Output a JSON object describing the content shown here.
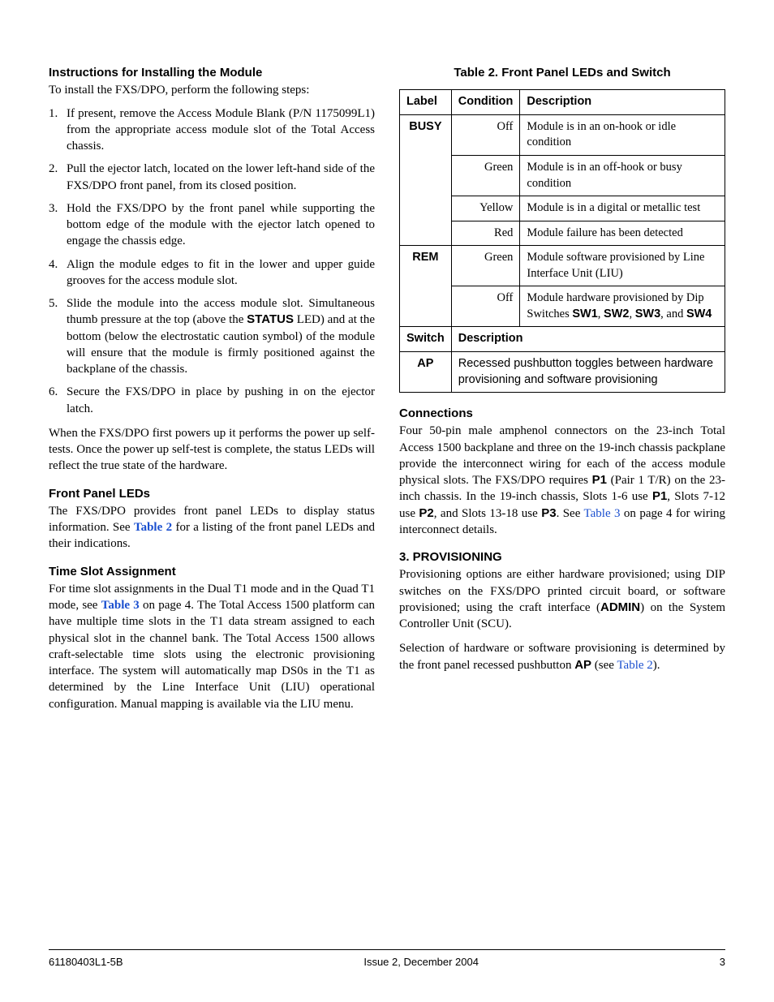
{
  "left": {
    "install_heading": "Instructions for Installing the Module",
    "install_intro": "To install the FXS/DPO, perform the following steps:",
    "steps": [
      "If present, remove the Access Module Blank (P/N 1175099L1) from the appropriate access module slot of the Total Access chassis.",
      "Pull the ejector latch, located on the lower left-hand side of the FXS/DPO front panel, from its closed position.",
      "Hold the FXS/DPO by the front panel while supporting the bottom edge of the module with the ejector latch opened to engage the chassis edge.",
      "Align the module edges to fit in the lower and upper guide grooves for the access module slot."
    ],
    "step5_pre": "Slide the module into the access module slot. Simultaneous thumb pressure at the top (above the ",
    "step5_bold": "STATUS",
    "step5_post": " LED) and at the bottom (below the electrostatic caution symbol) of the module will ensure that the module is firmly positioned against the backplane of the chassis.",
    "step6": "Secure the FXS/DPO in place by pushing in on the ejector latch.",
    "powerup_para": "When the FXS/DPO first powers up it performs the power up self-tests. Once the power up self-test is complete, the status LEDs will reflect the true state of the hardware.",
    "leds_heading": "Front Panel LEDs",
    "leds_para_pre": "The FXS/DPO provides front panel LEDs to display status information. See ",
    "leds_link": "Table 2",
    "leds_para_post": " for a listing of the front panel LEDs and their indications.",
    "timeslot_heading": "Time Slot Assignment",
    "timeslot_pre": "For time slot assignments in the Dual T1 mode and in the Quad T1 mode, see ",
    "timeslot_link": "Table 3",
    "timeslot_mid": " on page 4. The Total Access 1500 platform can have multiple time slots in the T1 data stream assigned to each physical slot in the channel bank. The Total Access 1500 allows craft-selectable time slots using the electronic provisioning interface. The system will automatically map DS0s in the T1 as determined by the Line Interface Unit (LIU) operational configuration. Manual mapping is available via the LIU menu."
  },
  "right": {
    "table_title": "Table 2.  Front Panel LEDs and Switch",
    "th_label": "Label",
    "th_condition": "Condition",
    "th_description": "Description",
    "rows": {
      "busy_label": "BUSY",
      "busy_off_cond": "Off",
      "busy_off_desc": "Module is in an on-hook or idle condition",
      "busy_green_cond": "Green",
      "busy_green_desc": "Module is in an off-hook or busy condition",
      "busy_yellow_cond": "Yellow",
      "busy_yellow_desc": "Module is in a digital or metallic test",
      "busy_red_cond": "Red",
      "busy_red_desc": "Module failure has been detected",
      "rem_label": "REM",
      "rem_green_cond": "Green",
      "rem_green_desc": "Module software provisioned by Line Interface Unit (LIU)",
      "rem_off_cond": "Off",
      "rem_off_desc_pre": "Module hardware provisioned by Dip Switches ",
      "rem_off_sw1": "SW1",
      "rem_off_sep1": ", ",
      "rem_off_sw2": "SW2",
      "rem_off_sep2": ", ",
      "rem_off_sw3": "SW3",
      "rem_off_and": ", and ",
      "rem_off_sw4": "SW4",
      "switch_h": "Switch",
      "switch_desc_h": "Description",
      "ap_label": "AP",
      "ap_desc": "Recessed pushbutton toggles between hardware provisioning and software provisioning"
    },
    "connections_heading": "Connections",
    "conn_p1_a": "Four 50-pin male amphenol connectors on the 23-inch Total Access 1500 backplane and three on the 19-inch chassis packplane provide the interconnect wiring for each of the access module physical slots. The FXS/DPO requires ",
    "conn_p1_b": "P1",
    "conn_p1_c": " (Pair 1 T/R) on the 23-inch chassis. In the 19-inch chassis, Slots 1-6 use ",
    "conn_p1_d": "P1",
    "conn_p1_e": ", Slots 7-12 use ",
    "conn_p1_f": "P2",
    "conn_p1_g": ", and Slots 13-18 use ",
    "conn_p1_h": "P3",
    "conn_p1_i": ". See ",
    "conn_link": "Table 3",
    "conn_p1_j": " on page 4 for wiring interconnect details.",
    "prov_heading": "3.  PROVISIONING",
    "prov_p1_a": "Provisioning options are either hardware provisioned; using DIP switches on the FXS/DPO printed circuit board, or software provisioned; using the craft interface (",
    "prov_p1_b": "ADMIN",
    "prov_p1_c": ") on the System Controller Unit (SCU).",
    "prov_p2_a": "Selection of hardware or software provisioning is determined by the front panel recessed pushbutton ",
    "prov_p2_b": "AP",
    "prov_p2_c": " (see ",
    "prov_link": "Table 2",
    "prov_p2_d": ")."
  },
  "footer": {
    "left": "61180403L1-5B",
    "center": "Issue 2, December 2004",
    "right": "3"
  }
}
